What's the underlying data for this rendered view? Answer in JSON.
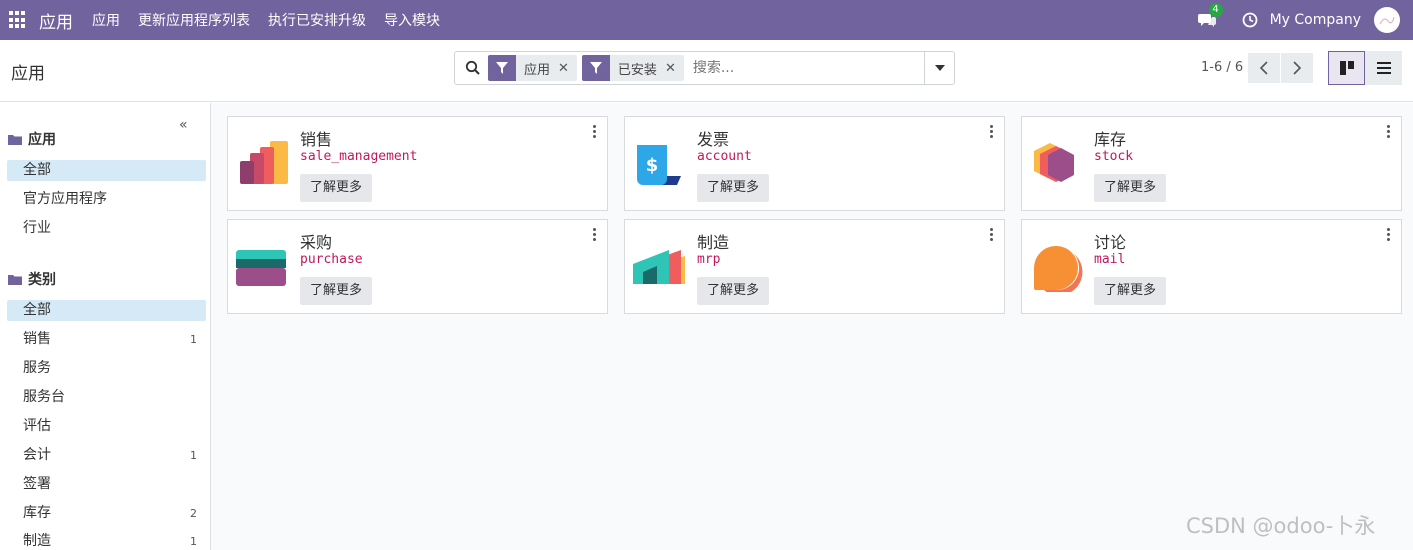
{
  "navbar": {
    "brand": "应用",
    "menu": [
      "应用",
      "更新应用程序列表",
      "执行已安排升级",
      "导入模块"
    ],
    "chat_badge": "4",
    "company": "My Company"
  },
  "control": {
    "title": "应用",
    "facets": [
      {
        "label": "应用"
      },
      {
        "label": "已安装"
      }
    ],
    "search_placeholder": "搜索...",
    "pager": "1-6 / 6"
  },
  "sidebar": {
    "collapse": "«",
    "sections": [
      {
        "title": "应用",
        "items": [
          {
            "label": "全部",
            "count": "",
            "active": true
          },
          {
            "label": "官方应用程序",
            "count": ""
          },
          {
            "label": "行业",
            "count": ""
          }
        ]
      },
      {
        "title": "类别",
        "items": [
          {
            "label": "全部",
            "count": "",
            "active": true
          },
          {
            "label": "销售",
            "count": "1"
          },
          {
            "label": "服务",
            "count": ""
          },
          {
            "label": "服务台",
            "count": ""
          },
          {
            "label": "评估",
            "count": ""
          },
          {
            "label": "会计",
            "count": "1"
          },
          {
            "label": "签署",
            "count": ""
          },
          {
            "label": "库存",
            "count": "2"
          },
          {
            "label": "制造",
            "count": "1"
          }
        ]
      }
    ]
  },
  "apps": [
    {
      "name": "销售",
      "technical": "sale_management",
      "button": "了解更多",
      "icon": "sales-icon"
    },
    {
      "name": "发票",
      "technical": "account",
      "button": "了解更多",
      "icon": "invoice-icon"
    },
    {
      "name": "库存",
      "technical": "stock",
      "button": "了解更多",
      "icon": "inventory-icon"
    },
    {
      "name": "采购",
      "technical": "purchase",
      "button": "了解更多",
      "icon": "purchase-icon"
    },
    {
      "name": "制造",
      "technical": "mrp",
      "button": "了解更多",
      "icon": "manufacturing-icon"
    },
    {
      "name": "讨论",
      "technical": "mail",
      "button": "了解更多",
      "icon": "discuss-icon"
    }
  ],
  "watermark": "CSDN @odoo-卜永",
  "colors": {
    "brand": "#71639e",
    "tech_name": "#c2185b",
    "badge": "#28a745",
    "active_filter": "#d6e9f7"
  }
}
